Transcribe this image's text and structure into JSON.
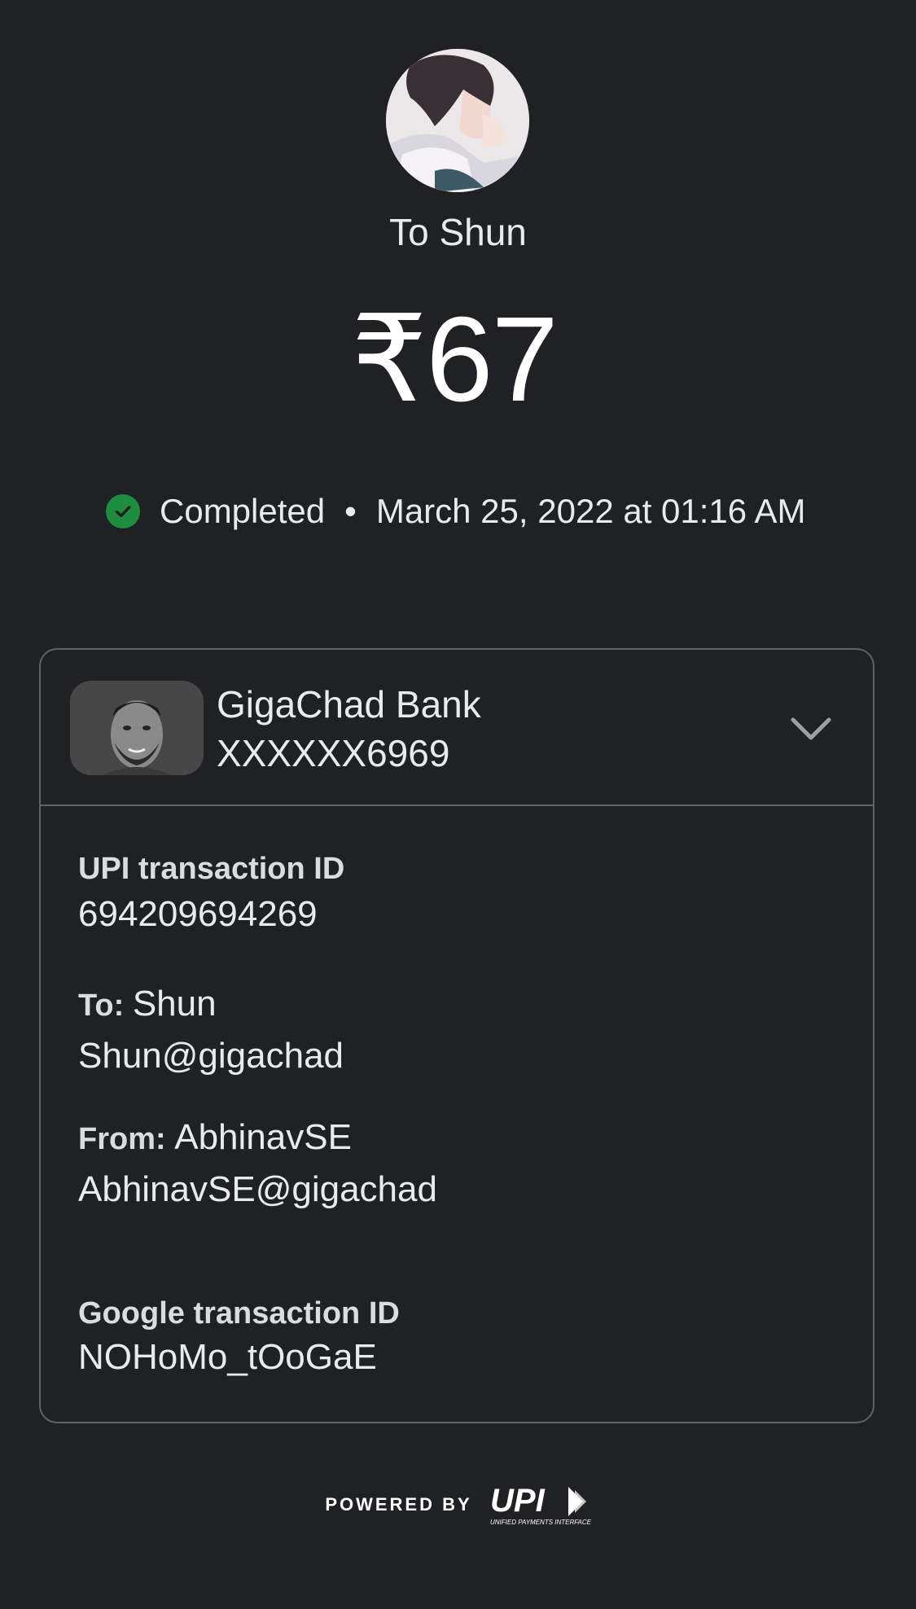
{
  "recipient": {
    "name_line": "To Shun",
    "avatar_icon": "profile-avatar"
  },
  "payment": {
    "amount": "₹67",
    "status": "Completed",
    "separator": "•",
    "datetime": "March 25, 2022 at 01:16 AM",
    "status_color": "#1e8e3e"
  },
  "account": {
    "bank_name": "GigaChad Bank",
    "account_number": "XXXXXX6969",
    "expand_icon": "chevron-down-icon"
  },
  "details": {
    "upi_label": "UPI transaction ID",
    "upi_value": "694209694269",
    "to_label": "To:",
    "to_name": "Shun",
    "to_vpa": "Shun@gigachad",
    "from_label": "From:",
    "from_name": "AbhinavSE",
    "from_vpa": "AbhinavSE@gigachad",
    "google_label": "Google transaction ID",
    "google_value": "NOHoMo_tOoGaE"
  },
  "footer": {
    "powered_by": "POWERED BY",
    "upi_logo_text": "UPI",
    "upi_logo_subtext": "UNIFIED PAYMENTS INTERFACE"
  },
  "colors": {
    "background": "#202124",
    "border": "#5f6368",
    "text": "#e8eaed"
  }
}
